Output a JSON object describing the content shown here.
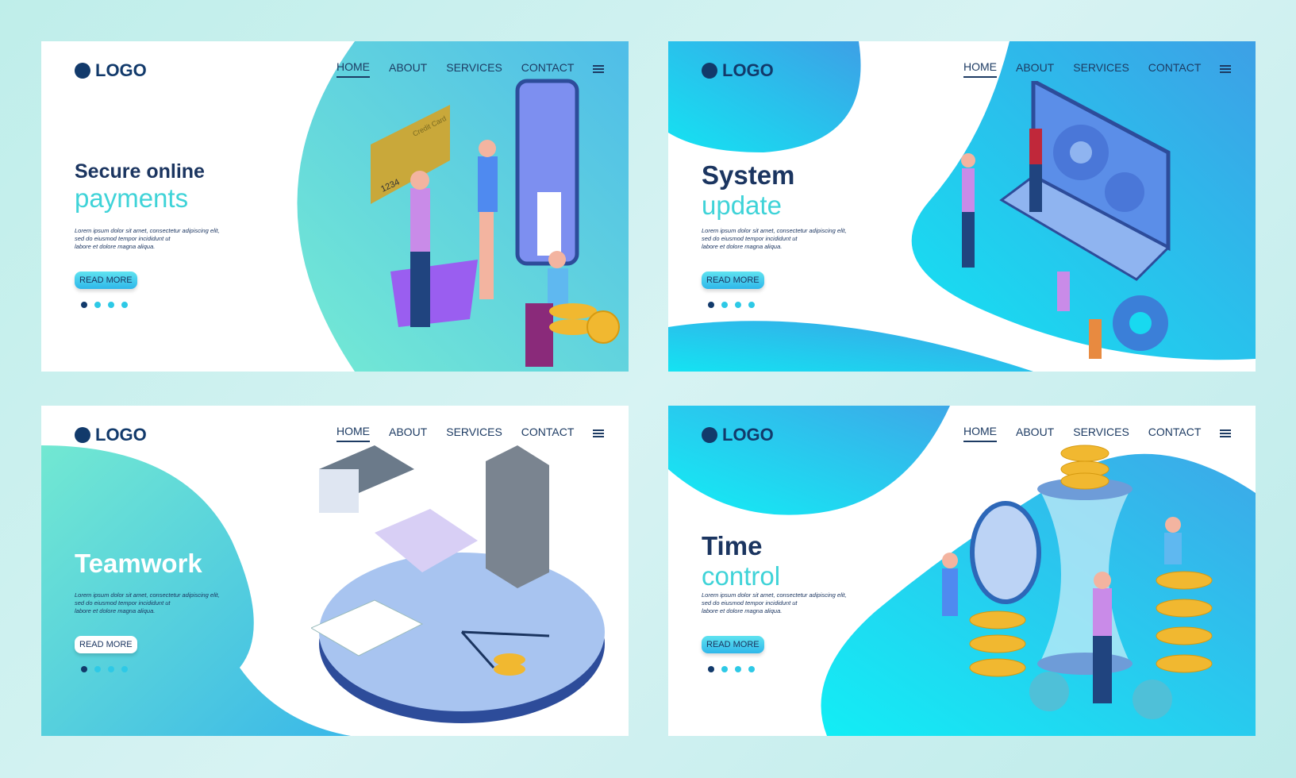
{
  "nav": {
    "home": "HOME",
    "about": "ABOUT",
    "services": "SERVICES",
    "contact": "CONTACT"
  },
  "logo": "LOGO",
  "lorem": [
    "Lorem ipsum dolor sit amet, consectetur adipiscing elit,",
    "sed do eiusmod tempor incididunt ut",
    "labore et dolore magna aliqua."
  ],
  "read_more": "READ MORE",
  "cards": [
    {
      "title_line1": "Secure online",
      "title_line2": "payments",
      "card_text": "Credit Card",
      "card_number": "1234",
      "illustration": "mobile-payment"
    },
    {
      "title_line1": "System",
      "title_line2": "update",
      "illustration": "laptop-gears"
    },
    {
      "title_line1": "Teamwork",
      "title_line2": "",
      "illustration": "clock-books"
    },
    {
      "title_line1": "Time",
      "title_line2": "control",
      "illustration": "hourglass-coins"
    }
  ],
  "colors": {
    "navy": "#123a6b",
    "teal": "#3fd3d8",
    "cyan": "#18d9f0",
    "blue": "#2fa3e8"
  }
}
